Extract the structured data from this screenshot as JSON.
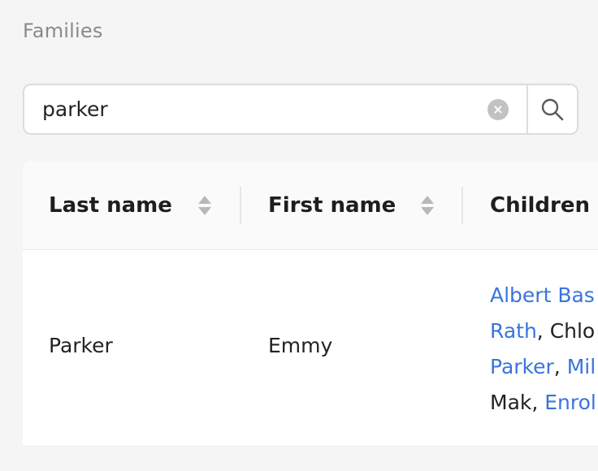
{
  "header": {
    "title": "Families"
  },
  "search": {
    "value": "parker",
    "clear_symbol": "×"
  },
  "table": {
    "columns": [
      {
        "label": "Last name",
        "sortable": true
      },
      {
        "label": "First name",
        "sortable": true
      },
      {
        "label": "Children",
        "sortable": false
      }
    ],
    "rows": [
      {
        "last_name": "Parker",
        "first_name": "Emmy",
        "children_lines": [
          [
            {
              "text": "Albert Bas",
              "link": true
            }
          ],
          [
            {
              "text": "Rath",
              "link": true
            },
            {
              "text": ", Chlo",
              "link": false
            }
          ],
          [
            {
              "text": "Parker",
              "link": true
            },
            {
              "text": ", ",
              "link": false
            },
            {
              "text": "Mil",
              "link": true
            }
          ],
          [
            {
              "text": "Mak, ",
              "link": false
            },
            {
              "text": "Enrol",
              "link": true
            }
          ]
        ]
      }
    ]
  },
  "colors": {
    "link": "#3a74dd",
    "background": "#f5f5f5",
    "header_bg": "#fafafa"
  }
}
